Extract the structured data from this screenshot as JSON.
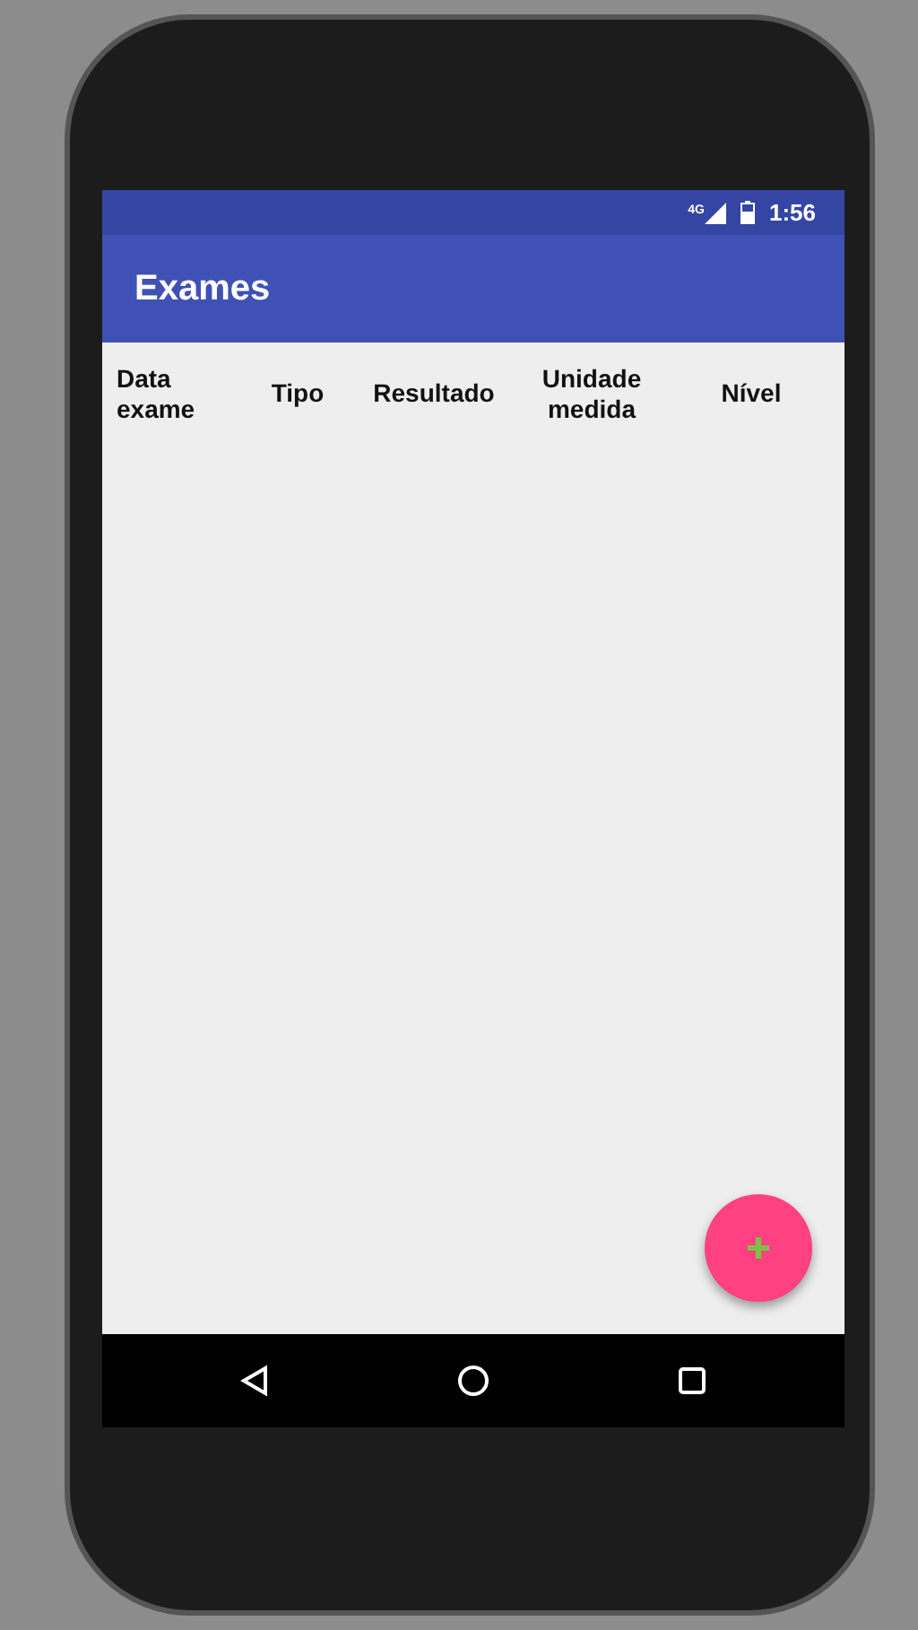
{
  "status_bar": {
    "network": "4G",
    "time": "1:56"
  },
  "toolbar": {
    "title": "Exames"
  },
  "table": {
    "columns": [
      "Data exame",
      "Tipo",
      "Resultado",
      "Unidade medida",
      "Nível"
    ]
  },
  "fab": {
    "kind": "add"
  },
  "nav_bar": {
    "buttons": [
      {
        "kind": "back"
      },
      {
        "kind": "home"
      },
      {
        "kind": "recents"
      }
    ]
  }
}
